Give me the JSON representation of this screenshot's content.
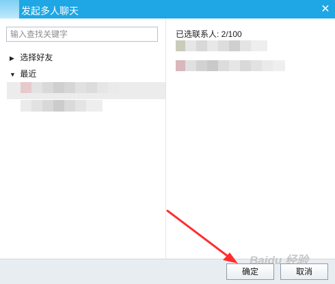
{
  "window": {
    "title": "发起多人聊天",
    "close_icon": "close-icon"
  },
  "search": {
    "placeholder": "输入查找关键字",
    "value": ""
  },
  "groups": [
    {
      "label": "选择好友",
      "expanded": false
    },
    {
      "label": "最近",
      "expanded": true
    }
  ],
  "selected": {
    "label": "已选联系人: 2/100"
  },
  "buttons": {
    "ok": "确定",
    "cancel": "取消"
  },
  "watermark": "Baidu 经验",
  "colors": {
    "titlebar": "#1ea7e4",
    "annotation_arrow": "#ff2d2d",
    "bottombar": "#e8edf1"
  }
}
